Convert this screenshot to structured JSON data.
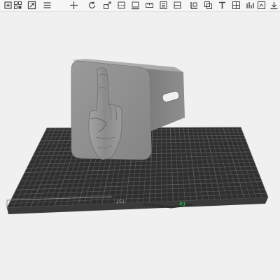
{
  "toolbar": {
    "tools": [
      {
        "name": "add-object-icon"
      },
      {
        "name": "grid-arrange-icon"
      },
      {
        "name": "auto-orient-icon"
      },
      {
        "name": "layout-icon"
      },
      {
        "name": "move-icon"
      },
      {
        "name": "rotate-icon"
      },
      {
        "name": "scale-icon"
      },
      {
        "name": "cut-icon"
      },
      {
        "name": "place-face-icon"
      },
      {
        "name": "measure-icon"
      },
      {
        "name": "support-paint-icon"
      },
      {
        "name": "seam-paint-icon"
      },
      {
        "name": "split-icon"
      },
      {
        "name": "boolean-icon"
      },
      {
        "name": "text-emboss-icon"
      },
      {
        "name": "assembly-icon"
      },
      {
        "name": "view-options-icon"
      },
      {
        "name": "variable-layer-icon"
      },
      {
        "name": "more-tools-icon"
      }
    ]
  },
  "viewport": {
    "bed_label": "TST",
    "axis_label": "01",
    "colors": {
      "bed": "#2f2f2f",
      "grid_line": "#5a5a5a",
      "model": "#8c8c8c",
      "background": "#f0f0f0",
      "axis": "#25a244"
    }
  }
}
